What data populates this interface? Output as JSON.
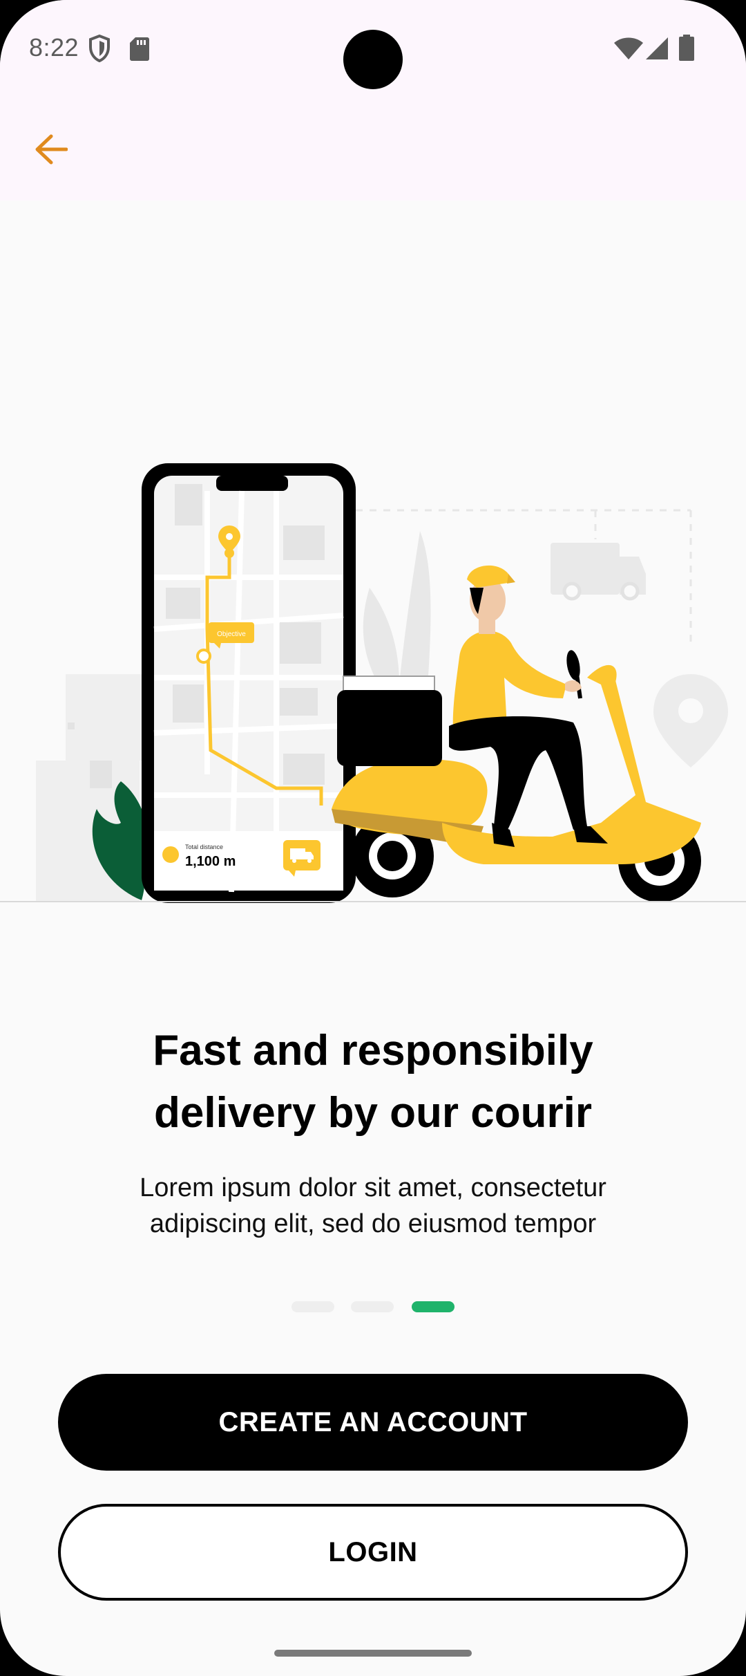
{
  "status_bar": {
    "time": "8:22",
    "icons": [
      "shield-icon",
      "sd-card-icon",
      "wifi-icon",
      "cell-signal-icon",
      "battery-icon"
    ]
  },
  "app_bar": {
    "back_icon": "arrow-back-icon",
    "accent_color": "#e08a1e"
  },
  "illustration": {
    "map_label": "Objective",
    "distance_label": "Total distance",
    "distance_value": "1,100 m",
    "icons": [
      "location-pin-icon",
      "delivery-truck-icon"
    ]
  },
  "onboarding": {
    "title_line1": "Fast and responsibily",
    "title_line2": "delivery by our courir",
    "subtitle_line1": "Lorem ipsum dolor sit amet, consectetur",
    "subtitle_line2": "adipiscing elit, sed do eiusmod tempor",
    "page_count": 3,
    "active_page": 3,
    "active_dot_color": "#1fb36b"
  },
  "actions": {
    "create_account_label": "CREATE AN ACCOUNT",
    "login_label": "LOGIN"
  }
}
